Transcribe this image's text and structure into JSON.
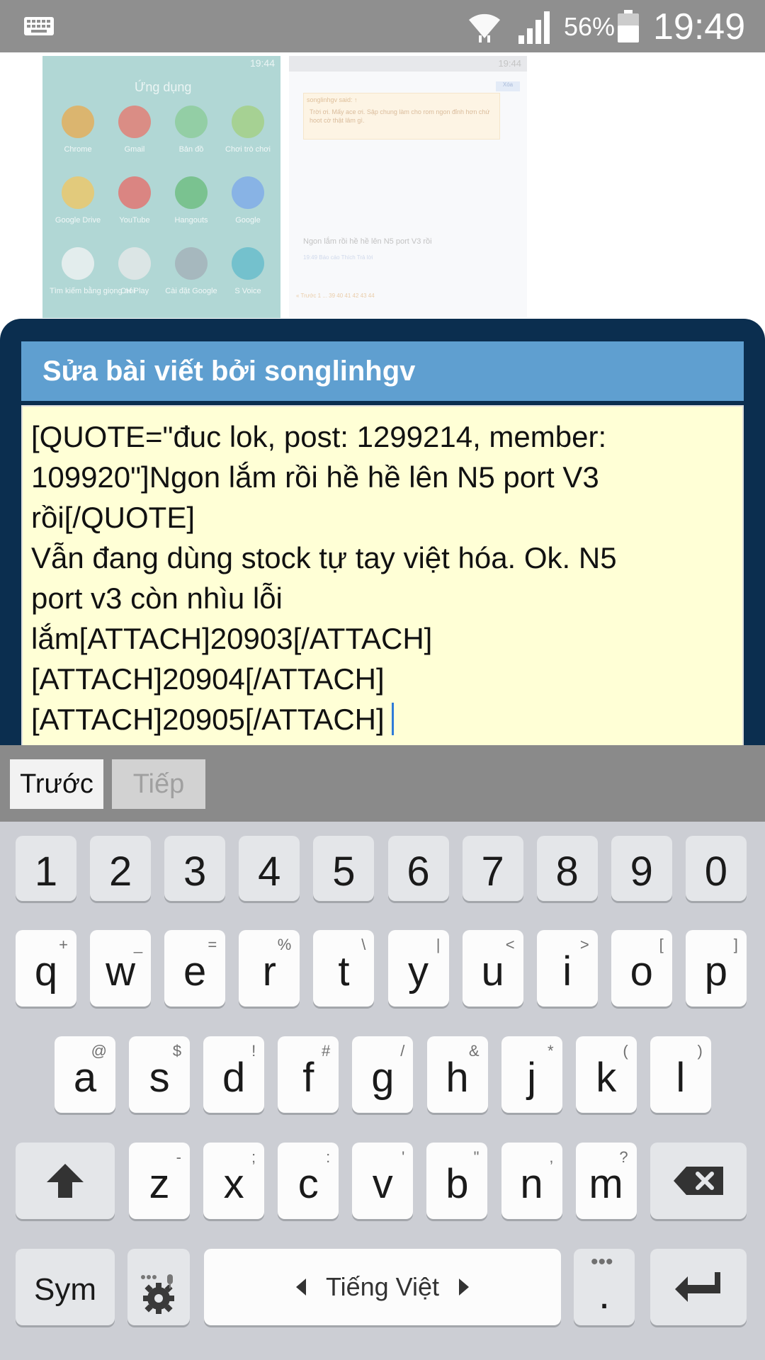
{
  "status_bar": {
    "battery_percent": "56%",
    "time": "19:49",
    "icons": [
      "keyboard-icon",
      "wifi-icon",
      "signal-icon",
      "battery-icon"
    ]
  },
  "background": {
    "apps_thumb": {
      "time": "19:44",
      "title": "Ứng dụng",
      "apps": [
        {
          "label": "Chrome",
          "color": "#e8a13a"
        },
        {
          "label": "Gmail",
          "color": "#e5655a"
        },
        {
          "label": "Bản đồ",
          "color": "#7dc68a"
        },
        {
          "label": "Chơi trò chơi",
          "color": "#9acb6f"
        },
        {
          "label": "Google Drive",
          "color": "#f2c04c"
        },
        {
          "label": "YouTube",
          "color": "#e65a56"
        },
        {
          "label": "Hangouts",
          "color": "#58b46a"
        },
        {
          "label": "Google",
          "color": "#6e9ee8"
        },
        {
          "label": "Tìm kiếm bằng giọng nói",
          "color": "#f4f4f4"
        },
        {
          "label": "CH Play",
          "color": "#e8e8e8"
        },
        {
          "label": "Cài đặt Google",
          "color": "#9aa6ad"
        },
        {
          "label": "S Voice",
          "color": "#4fb3c4"
        }
      ]
    },
    "forum_thumb": {
      "time": "19:44",
      "quote_title": "songlinhgv said: ↑",
      "quote_body": "Trời ơi. Mấy ace ơi. Sập chung làm cho rom ngon đỉnh hơn chứ hoot cờ thật lâm gì.",
      "button": "Xóa",
      "post": "Ngon lắm rồi hề hề lên N5 port V3 rồi",
      "meta": "19:49   Báo cáo                        Thích   Trả lời",
      "pager": "« Trước   1   ...   39   40   41   42   43   44"
    }
  },
  "dialog": {
    "title": "Sửa bài viết bởi songlinhgv",
    "editor_text": "[QUOTE=\"đuc lok, post: 1299214, member:\n109920\"]Ngon lắm rồi hề hề lên N5 port V3\nrồi[/QUOTE]\nVẫn đang dùng stock tự tay việt hóa. Ok. N5\nport v3 còn nhìu lỗi\nlắm[ATTACH]20903[/ATTACH]\n[ATTACH]20904[/ATTACH]\n[ATTACH]20905[/ATTACH]"
  },
  "nav": {
    "prev": "Trước",
    "next": "Tiếp"
  },
  "keyboard": {
    "row_numbers": [
      "1",
      "2",
      "3",
      "4",
      "5",
      "6",
      "7",
      "8",
      "9",
      "0"
    ],
    "row_q": [
      {
        "k": "q",
        "h": "+"
      },
      {
        "k": "w",
        "h": "_"
      },
      {
        "k": "e",
        "h": "="
      },
      {
        "k": "r",
        "h": "%"
      },
      {
        "k": "t",
        "h": "\\"
      },
      {
        "k": "y",
        "h": "|"
      },
      {
        "k": "u",
        "h": "<"
      },
      {
        "k": "i",
        "h": ">"
      },
      {
        "k": "o",
        "h": "["
      },
      {
        "k": "p",
        "h": "]"
      }
    ],
    "row_a": [
      {
        "k": "a",
        "h": "@"
      },
      {
        "k": "s",
        "h": "$"
      },
      {
        "k": "d",
        "h": "!"
      },
      {
        "k": "f",
        "h": "#"
      },
      {
        "k": "g",
        "h": "/"
      },
      {
        "k": "h",
        "h": "&"
      },
      {
        "k": "j",
        "h": "*"
      },
      {
        "k": "k",
        "h": "("
      },
      {
        "k": "l",
        "h": ")"
      }
    ],
    "row_z": [
      {
        "k": "z",
        "h": "-"
      },
      {
        "k": "x",
        "h": ";"
      },
      {
        "k": "c",
        "h": ":"
      },
      {
        "k": "v",
        "h": "'"
      },
      {
        "k": "b",
        "h": "\""
      },
      {
        "k": "n",
        "h": ","
      },
      {
        "k": "m",
        "h": "?"
      }
    ],
    "sym": "Sym",
    "space": "Tiếng Việt",
    "period": "."
  }
}
